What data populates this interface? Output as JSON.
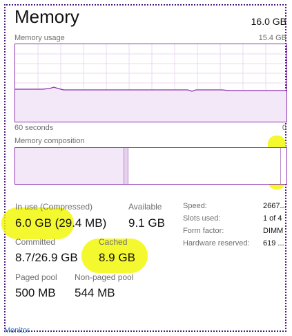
{
  "header": {
    "title": "Memory",
    "total": "16.0 GB"
  },
  "usage_graph": {
    "label": "Memory usage",
    "max_label": "15.4 GB",
    "time_left": "60 seconds",
    "time_right": "0",
    "fill_level": 0.39
  },
  "composition": {
    "label": "Memory composition",
    "in_use_fraction": 0.4,
    "modified_fraction": 0.015,
    "standby_fraction": 0.58
  },
  "stats": {
    "in_use_label": "In use (Compressed)",
    "in_use_value": "6.0 GB (29.4 MB)",
    "available_label": "Available",
    "available_value": "9.1 GB",
    "committed_label": "Committed",
    "committed_value": "8.7/26.9 GB",
    "cached_label": "Cached",
    "cached_value": "8.9 GB",
    "paged_label": "Paged pool",
    "paged_value": "500 MB",
    "nonpaged_label": "Non-paged pool",
    "nonpaged_value": "544 MB"
  },
  "properties": [
    {
      "label": "Speed:",
      "value": "2667..."
    },
    {
      "label": "Slots used:",
      "value": "1 of 4"
    },
    {
      "label": "Form factor:",
      "value": "DIMM"
    },
    {
      "label": "Hardware reserved:",
      "value": "619 ..."
    }
  ],
  "footer": {
    "monitor_link": "Monitor"
  },
  "colors": {
    "accent": "#8b2db0",
    "highlight": "#f2f700",
    "frame": "#4b1f7a"
  }
}
